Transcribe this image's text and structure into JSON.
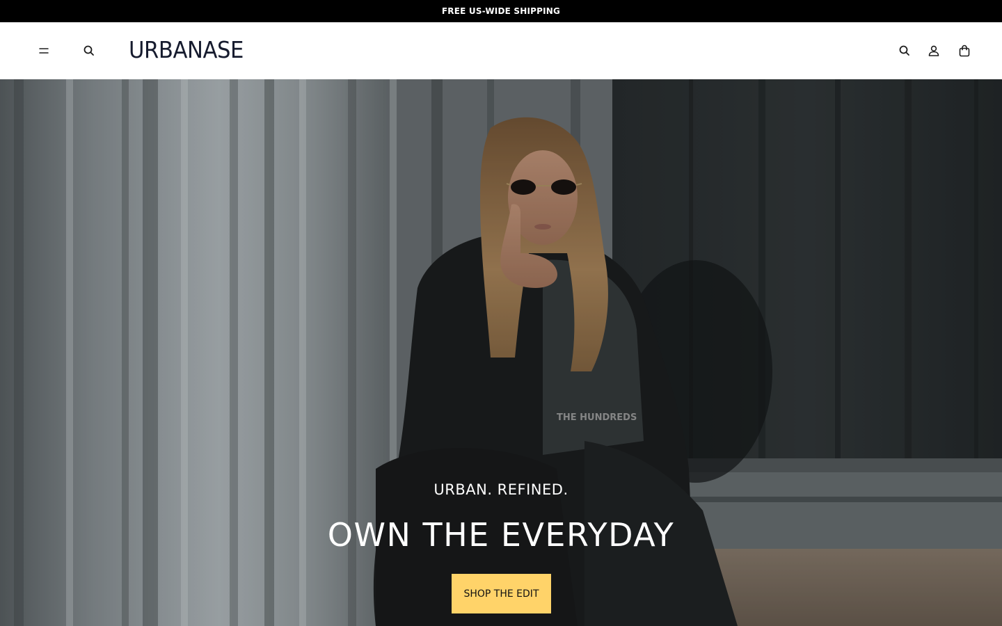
{
  "announcement": {
    "text": "FREE US-WIDE SHIPPING"
  },
  "header": {
    "logo": "URBANASE",
    "icons": {
      "menu": "hamburger-menu-icon",
      "search": "search-icon",
      "account": "user-icon",
      "cart": "shopping-bag-icon"
    }
  },
  "hero": {
    "subtitle": "URBAN. REFINED.",
    "title": "OWN THE EVERYDAY",
    "cta_label": "SHOP THE EDIT",
    "image_alt": "Woman in sunglasses and dark tracksuit crouching in front of a corrugated metal wall"
  },
  "colors": {
    "announcement_bg": "#000000",
    "logo": "#161b2e",
    "cta_bg": "#ffd369",
    "hero_text": "#ffffff"
  }
}
